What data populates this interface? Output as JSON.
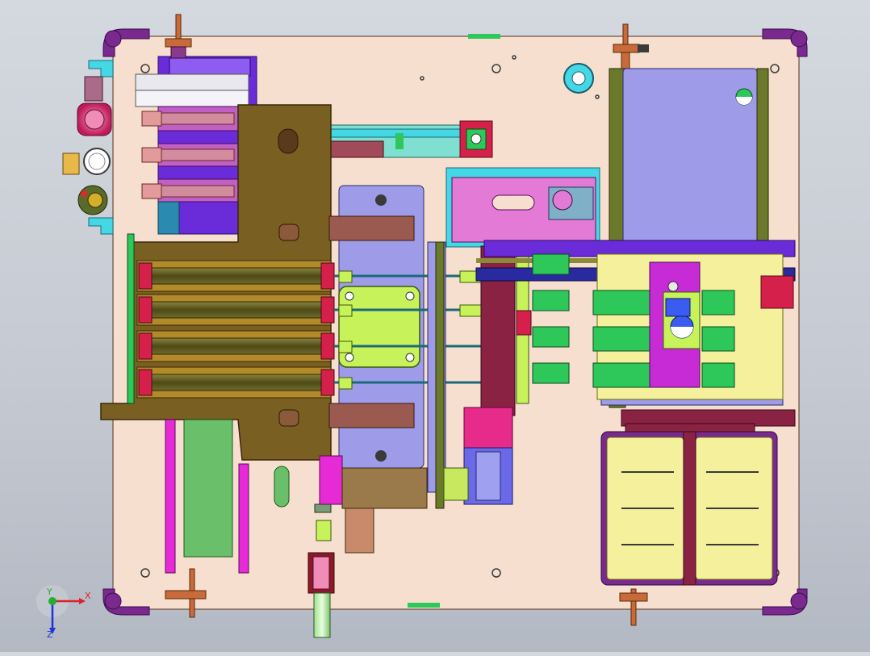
{
  "viewport": {
    "background_top": "#d4d8df",
    "background_bottom": "#b3b9c3"
  },
  "colors": {
    "base_plate": "#f6dfcf",
    "frame_brown": "#7a5f22",
    "frame_outline": "#3a2a08",
    "cylinder_rod": "#5f5a1f",
    "rail_maroon": "#8a2343",
    "lilac": "#9e9be8",
    "purple": "#6a2bd8",
    "magenta": "#e62bd6",
    "pink": "#e37ad6",
    "lime": "#c8f25a",
    "green": "#2ec85a",
    "yellow": "#f4f09c",
    "cyan": "#44d8e6",
    "teal": "#7fe0d2",
    "red": "#d4204a",
    "blue": "#3a5cf0",
    "gold": "#e8b848"
  },
  "coordinate_triad": {
    "x_label": "X",
    "y_label": "Y",
    "z_label": "Z",
    "x_color": "#e0202a",
    "y_color": "#20b030",
    "z_color": "#2030e0"
  }
}
